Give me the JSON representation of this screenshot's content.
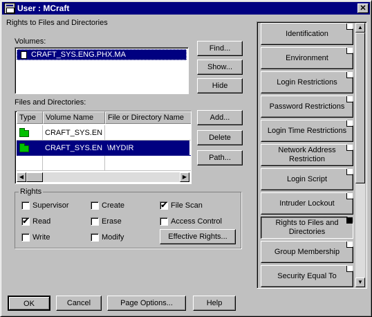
{
  "window": {
    "title": "User : MCraft",
    "close_glyph": "✕"
  },
  "section_title": "Rights to Files and Directories",
  "volumes": {
    "label": "Volumes:",
    "items": [
      "CRAFT_SYS.ENG.PHX.MA"
    ]
  },
  "buttons_top": {
    "find": "Find...",
    "show": "Show...",
    "hide": "Hide"
  },
  "files": {
    "label": "Files and Directories:",
    "columns": [
      "Type",
      "Volume Name",
      "File or Directory Name"
    ],
    "rows": [
      {
        "volume": "CRAFT_SYS.EN",
        "path": ""
      },
      {
        "volume": "CRAFT_SYS.EN",
        "path": "\\MYDIR"
      }
    ]
  },
  "buttons_mid": {
    "add": "Add...",
    "delete": "Delete",
    "path": "Path..."
  },
  "rights": {
    "label": "Rights",
    "supervisor": "Supervisor",
    "read": "Read",
    "write": "Write",
    "create": "Create",
    "erase": "Erase",
    "modify": "Modify",
    "file_scan": "File Scan",
    "access_control": "Access Control",
    "effective": "Effective Rights...",
    "checked": {
      "supervisor": false,
      "read": true,
      "write": false,
      "create": false,
      "erase": false,
      "modify": false,
      "file_scan": true,
      "access_control": false
    }
  },
  "pages": [
    "Identification",
    "Environment",
    "Login Restrictions",
    "Password Restrictions",
    "Login Time Restrictions",
    "Network Address Restriction",
    "Login Script",
    "Intruder Lockout",
    "Rights to Files and Directories",
    "Group Membership",
    "Security Equal To"
  ],
  "selected_page": "Rights to Files and Directories",
  "footer": {
    "ok": "OK",
    "cancel": "Cancel",
    "page_options": "Page Options...",
    "help": "Help"
  },
  "colors": {
    "title_bar": "#000080",
    "selection": "#000080",
    "folder": "#00c000",
    "face": "#c0c0c0"
  },
  "icons": {
    "check": "✔",
    "scroll_up": "▲",
    "scroll_down": "▼",
    "scroll_left": "◀",
    "scroll_right": "▶"
  }
}
